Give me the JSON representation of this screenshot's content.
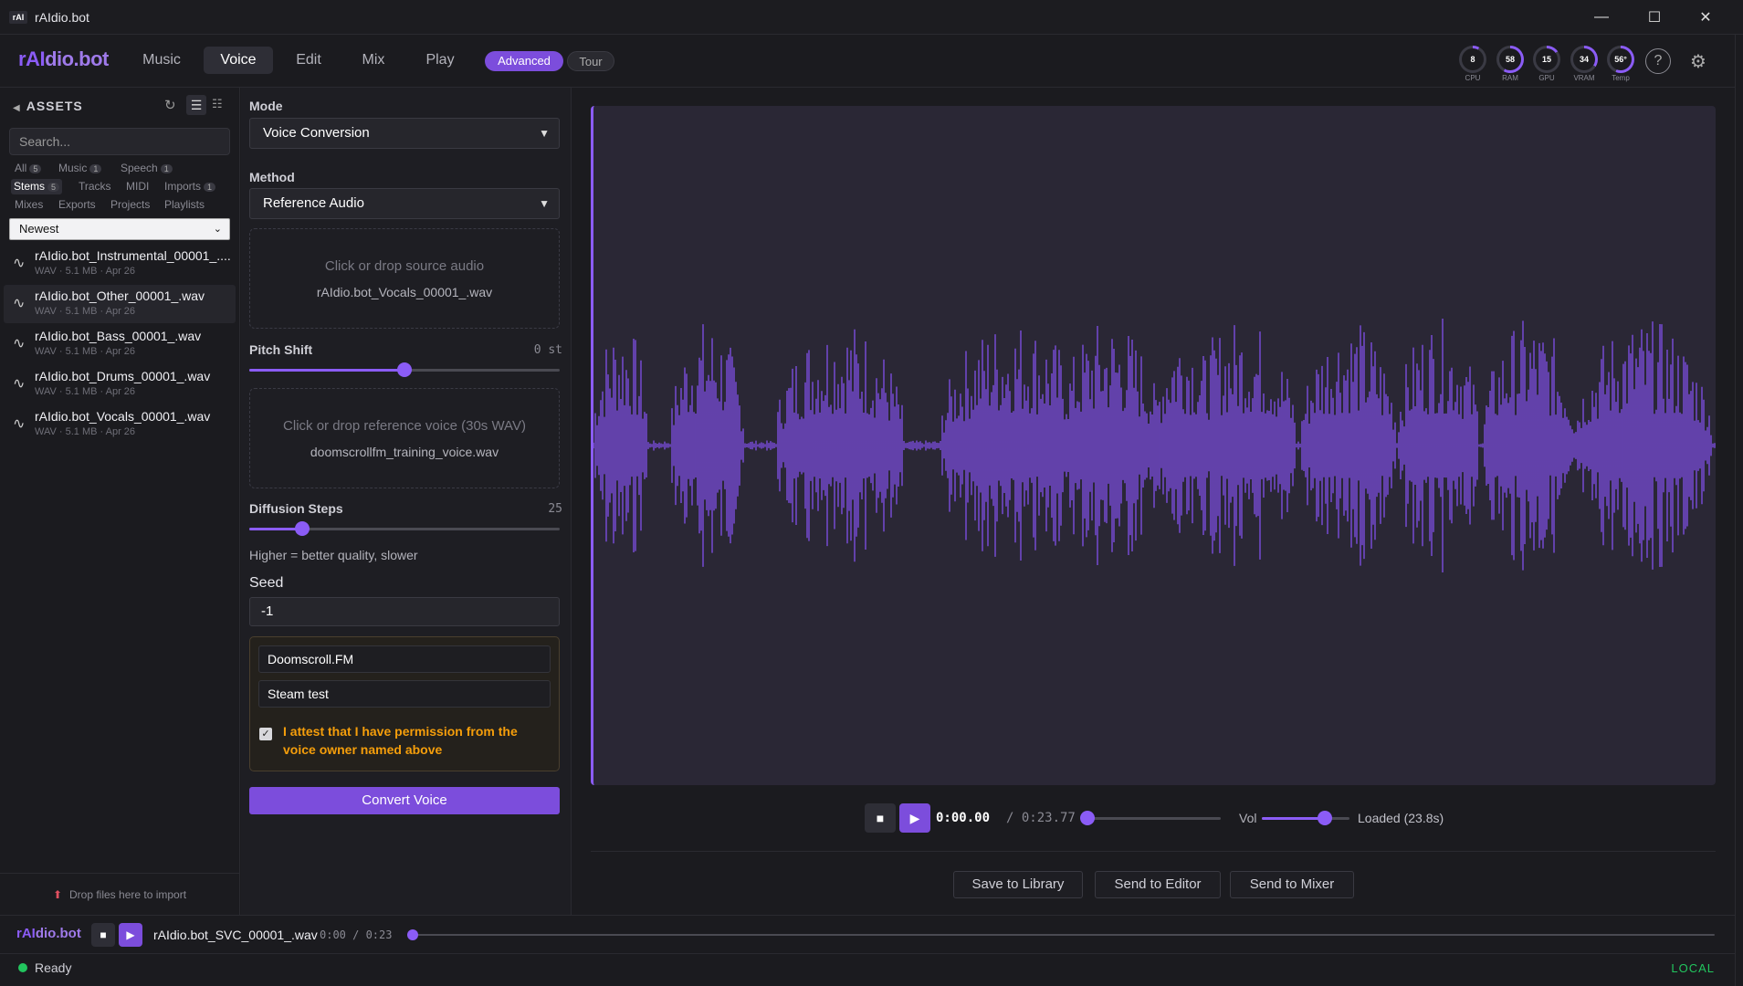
{
  "titlebar": {
    "logo": "rAI",
    "title": "rAIdio.bot",
    "minimize": "—",
    "maximize": "☐",
    "close": "✕"
  },
  "brand": {
    "part1": "rAI",
    "part2": "dio.bot"
  },
  "nav": {
    "tabs": [
      "Music",
      "Voice",
      "Edit",
      "Mix",
      "Play"
    ],
    "active": "Voice",
    "advanced": "Advanced",
    "tour": "Tour"
  },
  "gauges": [
    {
      "label": "CPU",
      "value": "8",
      "percent": 8
    },
    {
      "label": "RAM",
      "value": "58",
      "percent": 58
    },
    {
      "label": "GPU",
      "value": "15",
      "percent": 15
    },
    {
      "label": "VRAM",
      "value": "34",
      "percent": 34
    },
    {
      "label": "Temp",
      "value": "56°",
      "percent": 56
    }
  ],
  "header_icons": {
    "help": "?",
    "settings": "⚙"
  },
  "colors": {
    "accent": "#8b5cf6",
    "warning": "#f59e0b",
    "ok": "#22c55e"
  },
  "sidebar": {
    "title": "ASSETS",
    "search_placeholder": "Search...",
    "filters": {
      "all": {
        "label": "All",
        "count": "5"
      },
      "music": {
        "label": "Music",
        "count": "1"
      },
      "speech": {
        "label": "Speech",
        "count": "1"
      },
      "stems": {
        "label": "Stems",
        "count": "5"
      },
      "tracks": {
        "label": "Tracks"
      },
      "midi": {
        "label": "MIDI"
      },
      "imports": {
        "label": "Imports",
        "count": "1"
      },
      "mixes": {
        "label": "Mixes"
      },
      "exports": {
        "label": "Exports"
      },
      "projects": {
        "label": "Projects"
      },
      "playlists": {
        "label": "Playlists"
      }
    },
    "sort": "Newest",
    "assets": [
      {
        "name": "rAIdio.bot_Instrumental_00001_....",
        "meta": "WAV · 5.1 MB · Apr 26"
      },
      {
        "name": "rAIdio.bot_Other_00001_.wav",
        "meta": "WAV · 5.1 MB · Apr 26"
      },
      {
        "name": "rAIdio.bot_Bass_00001_.wav",
        "meta": "WAV · 5.1 MB · Apr 26"
      },
      {
        "name": "rAIdio.bot_Drums_00001_.wav",
        "meta": "WAV · 5.1 MB · Apr 26"
      },
      {
        "name": "rAIdio.bot_Vocals_00001_.wav",
        "meta": "WAV · 5.1 MB · Apr 26"
      }
    ],
    "drop_text": "Drop files here to import"
  },
  "panel": {
    "mode_label": "Mode",
    "mode_value": "Voice Conversion",
    "method_label": "Method",
    "method_value": "Reference Audio",
    "source_prompt": "Click or drop source audio",
    "source_file": "rAIdio.bot_Vocals_00001_.wav",
    "pitch_label": "Pitch Shift",
    "pitch_value": "0 st",
    "pitch_fraction": 0.5,
    "ref_prompt": "Click or drop reference voice (30s WAV)",
    "ref_file": "doomscrollfm_training_voice.wav",
    "steps_label": "Diffusion Steps",
    "steps_value": "25",
    "steps_fraction": 0.17,
    "steps_hint": "Higher = better quality, slower",
    "seed_label": "Seed",
    "seed_value": "-1",
    "owner_name": "Doomscroll.FM",
    "owner_note": "Steam test",
    "attest": "I attest that I have permission from the voice owner named above",
    "attest_checked": true,
    "convert": "Convert Voice"
  },
  "player": {
    "current": "0:00.00",
    "total": "/ 0:23.77",
    "progress_fraction": 0.0,
    "vol_label": "Vol",
    "volume_fraction": 0.72,
    "status": "Loaded (23.8s)"
  },
  "actions": {
    "save": "Save to Library",
    "editor": "Send to Editor",
    "mixer": "Send to Mixer"
  },
  "footer": {
    "brand1": "rAI",
    "brand2": "dio.bot",
    "file": "rAIdio.bot_SVC_00001_.wav",
    "time": "0:00 / 0:23",
    "progress_fraction": 0.0
  },
  "status": {
    "text": "Ready",
    "mode": "LOCAL"
  }
}
